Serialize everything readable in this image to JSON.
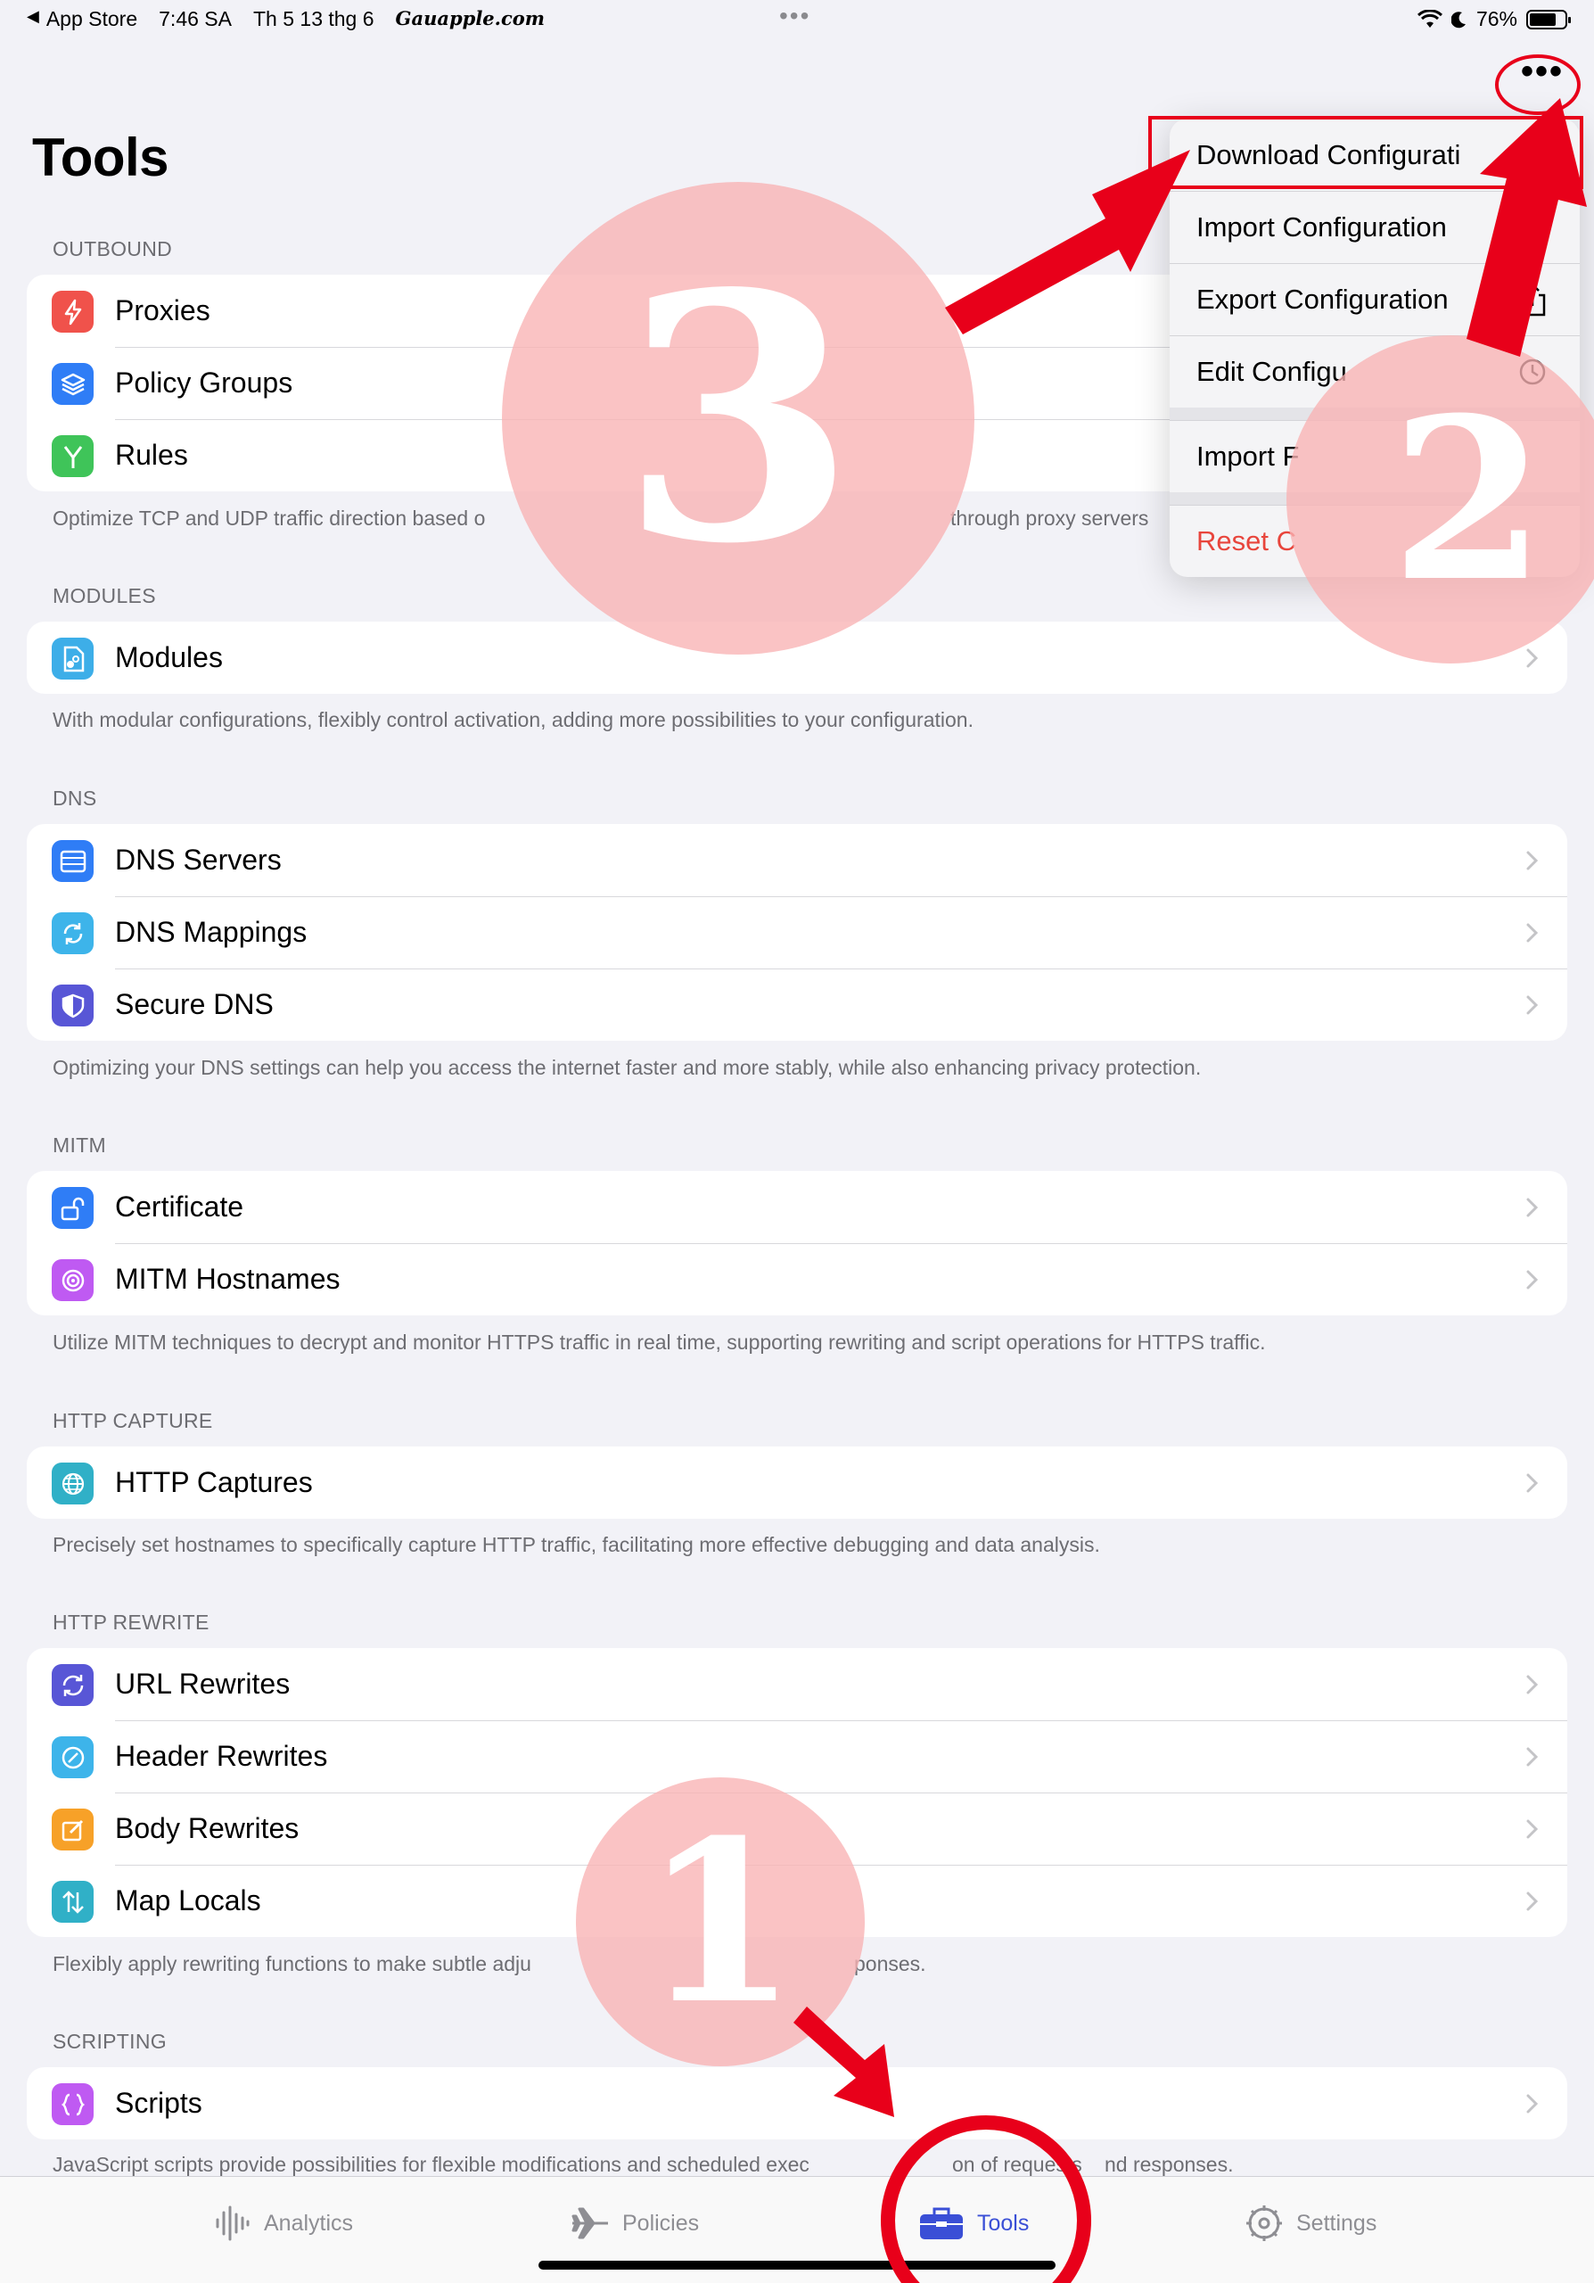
{
  "status_bar": {
    "back_app": "App Store",
    "time": "7:46 SA",
    "date": "Th 5 13 thg 6",
    "brand": "Gauapple.com",
    "battery": "76%",
    "battery_level": 0.76
  },
  "page_title": "Tools",
  "sections": [
    {
      "header": "OUTBOUND",
      "items": [
        {
          "label": "Proxies",
          "icon": "bolt-icon",
          "color": "#f0524b"
        },
        {
          "label": "Policy Groups",
          "icon": "layers-icon",
          "color": "#2f7df6"
        },
        {
          "label": "Rules",
          "icon": "fork-icon",
          "color": "#3fc459"
        }
      ],
      "footer": "Optimize TCP and UDP traffic direction based o"
    },
    {
      "header": "MODULES",
      "items": [
        {
          "label": "Modules",
          "icon": "module-icon",
          "color": "#3daee8"
        }
      ],
      "footer": "With modular configurations, flexibly control activation, adding more possibilities to your configuration."
    },
    {
      "header": "DNS",
      "items": [
        {
          "label": "DNS Servers",
          "icon": "server-icon",
          "color": "#2f7df6"
        },
        {
          "label": "DNS Mappings",
          "icon": "refresh-icon",
          "color": "#3db4ea"
        },
        {
          "label": "Secure DNS",
          "icon": "shield-icon",
          "color": "#5856d6"
        }
      ],
      "footer": "Optimizing your DNS settings can help you access the internet faster and more stably, while also enhancing privacy protection."
    },
    {
      "header": "MITM",
      "items": [
        {
          "label": "Certificate",
          "icon": "unlock-icon",
          "color": "#2f7df6"
        },
        {
          "label": "MITM Hostnames",
          "icon": "target-icon",
          "color": "#bf5af2"
        }
      ],
      "footer": "Utilize MITM techniques to decrypt and monitor HTTPS traffic in real time, supporting rewriting and script operations for HTTPS traffic."
    },
    {
      "header": "HTTP CAPTURE",
      "items": [
        {
          "label": "HTTP Captures",
          "icon": "globe-icon",
          "color": "#30b0c7"
        }
      ],
      "footer": "Precisely set hostnames to specifically capture HTTP traffic, facilitating more effective debugging and data analysis."
    },
    {
      "header": "HTTP REWRITE",
      "items": [
        {
          "label": "URL Rewrites",
          "icon": "cycle-icon",
          "color": "#5856d6"
        },
        {
          "label": "Header Rewrites",
          "icon": "slash-circle-icon",
          "color": "#3db4ea"
        },
        {
          "label": "Body Rewrites",
          "icon": "edit-icon",
          "color": "#f7a128"
        },
        {
          "label": "Map Locals",
          "icon": "arrows-updown-icon",
          "color": "#30b0c7"
        }
      ],
      "footer": "Flexibly apply rewriting functions to make subtle adju"
    },
    {
      "header": "SCRIPTING",
      "items": [
        {
          "label": "Scripts",
          "icon": "braces-icon",
          "color": "#bf5af2"
        }
      ],
      "footer": "JavaScript scripts provide possibilities for flexible modifications and scheduled exec"
    }
  ],
  "section1_footer_tail": "through proxy servers",
  "section6_footer_tail": "ponses.",
  "section7_footer_mid": "on of requests",
  "section7_footer_tail": "nd responses.",
  "menu": {
    "items": [
      {
        "label": "Download Configurati",
        "icon": ""
      },
      {
        "label": "Import Configuration",
        "icon": "download-icon"
      },
      {
        "label": "Export Configuration",
        "icon": "share-icon"
      },
      {
        "label": "Edit Configu",
        "icon": "history-icon"
      },
      {
        "label": "Import F",
        "icon": ""
      },
      {
        "label": "Reset C",
        "icon": ""
      }
    ]
  },
  "tab_bar": {
    "tabs": [
      {
        "label": "Analytics",
        "icon": "waveform-icon"
      },
      {
        "label": "Policies",
        "icon": "airplane-icon"
      },
      {
        "label": "Tools",
        "icon": "toolbox-icon",
        "active": true
      },
      {
        "label": "Settings",
        "icon": "gear-icon"
      }
    ]
  },
  "annotations": {
    "step1": "1",
    "step2": "2",
    "step3": "3",
    "accent": "#e8001a"
  }
}
